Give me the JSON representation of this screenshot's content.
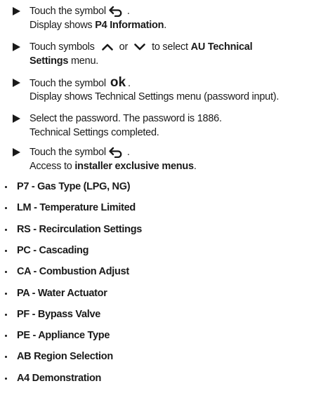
{
  "steps": [
    {
      "line1_pre": "Touch the symbol",
      "line1_post": ".",
      "line1_icon": "back-arrow-icon",
      "line2_pre": "Display shows ",
      "line2_bold": "P4 Information",
      "line2_post": "."
    },
    {
      "line1_pre": "Touch symbols",
      "line1_mid": "or",
      "line1_post": "to select ",
      "line1_bold": "AU Technical",
      "line1_icon_up": "chevron-up-icon",
      "line1_icon_down": "chevron-down-icon",
      "line2_bold": "Settings",
      "line2_post": " menu."
    },
    {
      "line1_pre": "Touch the symbol",
      "line1_symbol": "ok",
      "line1_post": ".",
      "line2_text": "Display shows Technical Settings menu (password input)."
    },
    {
      "line1_text": "Select the password. The password is 1886.",
      "line2_text": "Technical Settings completed."
    },
    {
      "line1_pre": "Touch the symbol",
      "line1_post": ".",
      "line1_icon": "back-arrow-icon",
      "line2_pre": "Access to ",
      "line2_bold": "installer exclusive menus",
      "line2_post": "."
    }
  ],
  "menus": [
    "P7 - Gas Type (LPG, NG)",
    "LM - Temperature Limited",
    "RS - Recirculation Settings",
    "PC - Cascading",
    "CA - Combustion Adjust",
    "PA - Water Actuator",
    "PF - Bypass Valve",
    "PE - Appliance Type",
    "AB Region Selection",
    "A4 Demonstration"
  ]
}
